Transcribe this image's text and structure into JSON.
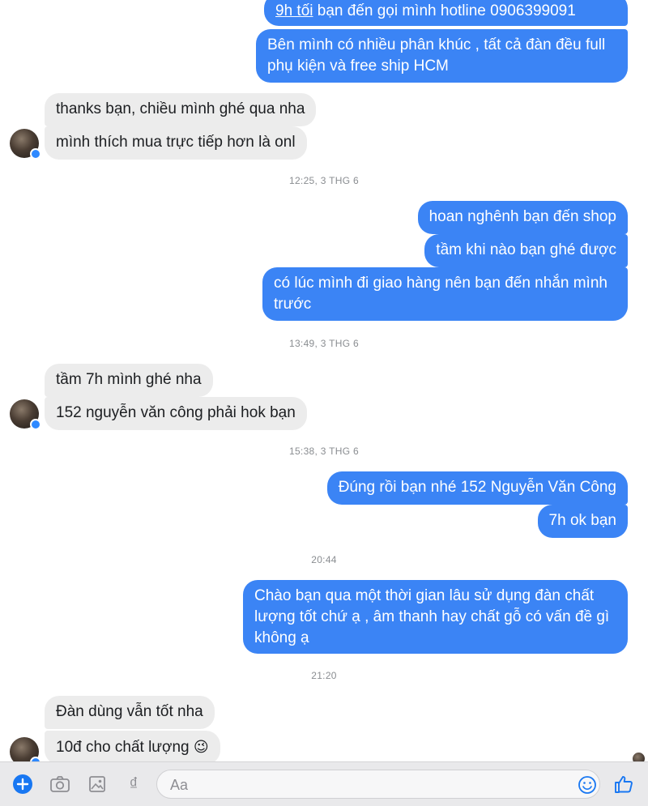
{
  "conversation": {
    "messages": [
      {
        "side": "out",
        "text": "bạn đến gọi mình hotline 0906399091",
        "prefix": "9h tối"
      },
      {
        "side": "out",
        "text": "Bên mình có nhiều phân khúc , tất cả đàn đều full phụ kiện và free ship HCM"
      },
      {
        "side": "in",
        "text": "thanks bạn, chiều mình ghé qua nha"
      },
      {
        "side": "in",
        "text": "mình thích mua trực tiếp hơn là onl"
      },
      {
        "side": "out",
        "text": "hoan nghênh bạn đến shop"
      },
      {
        "side": "out",
        "text": "tầm khi nào bạn ghé được"
      },
      {
        "side": "out",
        "text": "có lúc mình đi giao hàng nên bạn đến nhắn mình trước"
      },
      {
        "side": "in",
        "text": "tầm 7h mình ghé nha"
      },
      {
        "side": "in",
        "text": "152 nguyễn văn công phải hok bạn"
      },
      {
        "side": "out",
        "text": "Đúng rồi bạn nhé 152 Nguyễn Văn Công"
      },
      {
        "side": "out",
        "text": "7h ok bạn"
      },
      {
        "side": "out",
        "text": "Chào bạn qua một thời gian lâu sử dụng đàn chất lượng tốt chứ ạ , âm thanh hay chất gỗ có vấn đề gì không ạ"
      },
      {
        "side": "in",
        "text": "Đàn dùng vẫn tốt nha"
      },
      {
        "side": "in",
        "text": "10đ cho chất lượng",
        "emoji": "😉"
      }
    ],
    "timestamps": [
      "12:25, 3 THG 6",
      "13:49, 3 THG 6",
      "15:38, 3 THG 6",
      "20:44",
      "21:20"
    ]
  },
  "composer": {
    "placeholder": "Aa",
    "icons": [
      "plus-icon",
      "camera-icon",
      "image-icon",
      "dong-currency-icon",
      "emoji-icon",
      "thumbs-up-icon"
    ],
    "dong_symbol": "₫"
  },
  "colors": {
    "outgoing": "#3b84f5",
    "incoming": "#ececec",
    "accent": "#1877f2"
  }
}
